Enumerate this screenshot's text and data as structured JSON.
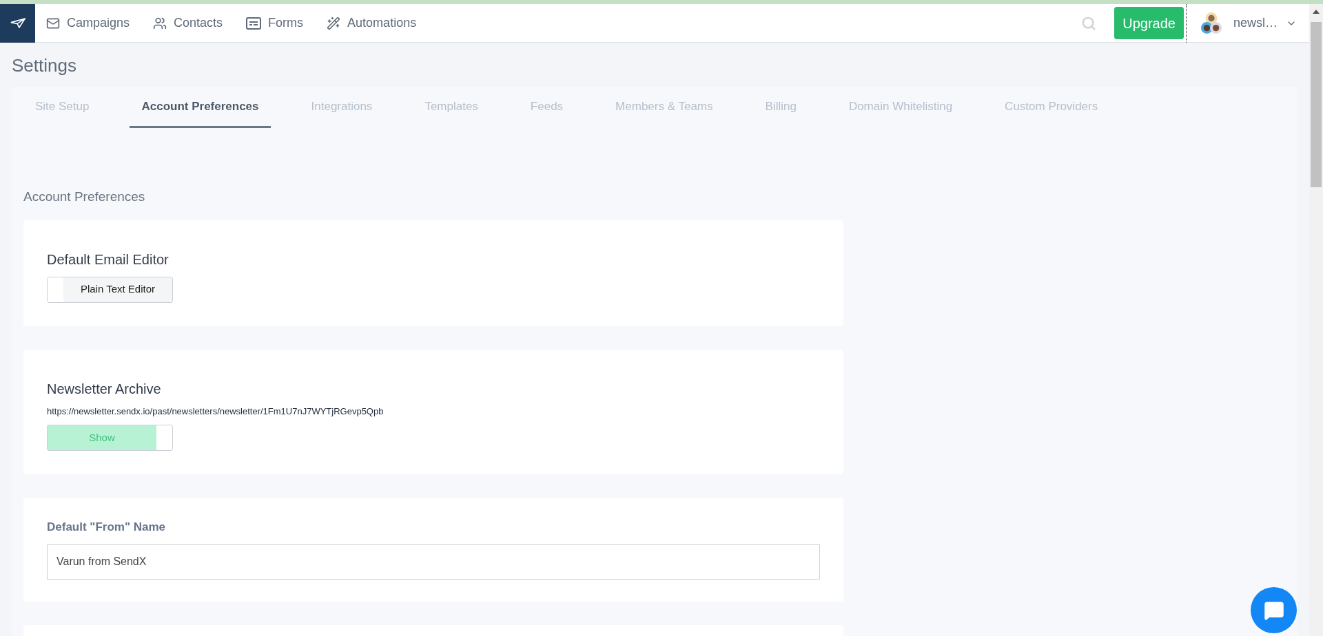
{
  "nav": {
    "items": [
      {
        "label": "Campaigns",
        "kind": "mail"
      },
      {
        "label": "Contacts",
        "kind": "people"
      },
      {
        "label": "Forms",
        "kind": "form"
      },
      {
        "label": "Automations",
        "kind": "wand"
      }
    ],
    "upgrade": "Upgrade",
    "account": "newsl…"
  },
  "page_title": "Settings",
  "tabs": [
    {
      "label": "Site Setup",
      "selected": false
    },
    {
      "label": "Account Preferences",
      "selected": true
    },
    {
      "label": "Integrations",
      "selected": false
    },
    {
      "label": "Templates",
      "selected": false
    },
    {
      "label": "Feeds",
      "selected": false
    },
    {
      "label": "Members & Teams",
      "selected": false
    },
    {
      "label": "Billing",
      "selected": false
    },
    {
      "label": "Domain Whitelisting",
      "selected": false
    },
    {
      "label": "Custom Providers",
      "selected": false
    }
  ],
  "section_title": "Account Preferences",
  "cards": [
    {
      "kind": "toggle",
      "title": "Default Email Editor",
      "toggle": {
        "label": "Plain Text Editor",
        "on": false
      }
    },
    {
      "kind": "toggle",
      "title": "Newsletter Archive",
      "url": "https://newsletter.sendx.io/past/newsletters/newsletter/1Fm1U7nJ7WYTjRGevp5Qpb",
      "toggle": {
        "label": "Show",
        "on": true
      }
    },
    {
      "kind": "field",
      "label": "Default \"From\" Name",
      "value": "Varun from SendX"
    }
  ]
}
